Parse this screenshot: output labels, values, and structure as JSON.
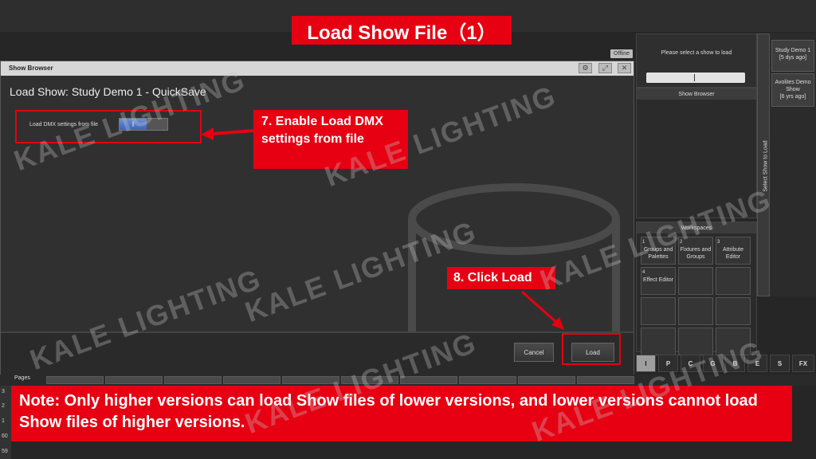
{
  "banner_title": "Load Show File（1）",
  "offline_label": "Offline",
  "dialog": {
    "header": "Show Browser",
    "title": "Load Show: Study Demo 1 - QuickSave",
    "option_label": "Load DMX settings from file",
    "toggle_value": "I",
    "cancel_label": "Cancel",
    "load_label": "Load"
  },
  "right_panel": {
    "select_prompt": "Please select a show to load",
    "progress_value": "I",
    "browser_label": "Show Browser",
    "vertical_label": "Select Show to Load",
    "shows": [
      {
        "name": "Study Demo 1",
        "age": "[5 dys ago]"
      },
      {
        "name": "Avolites Demo Show",
        "age": "[6 yrs ago]"
      }
    ],
    "workspaces_label": "Workspaces",
    "workspaces": [
      {
        "num": "1",
        "name": "Groups and Palettes"
      },
      {
        "num": "2",
        "name": "Fixtures and Groups"
      },
      {
        "num": "3",
        "name": "Attribute Editor"
      },
      {
        "num": "4",
        "name": "Effect Editor"
      },
      {
        "num": "",
        "name": ""
      },
      {
        "num": "",
        "name": ""
      },
      {
        "num": "",
        "name": ""
      },
      {
        "num": "",
        "name": ""
      },
      {
        "num": "",
        "name": ""
      },
      {
        "num": "",
        "name": ""
      },
      {
        "num": "",
        "name": ""
      },
      {
        "num": "",
        "name": ""
      }
    ],
    "modes": [
      "I",
      "P",
      "C",
      "G",
      "B",
      "E",
      "S",
      "FX"
    ]
  },
  "pages_label": "Pages",
  "left_numbers": [
    "3",
    "2",
    "1",
    "60",
    "59"
  ],
  "annotations": {
    "step7": "7. Enable Load DMX settings from file",
    "step8": "8. Click Load",
    "note": "Note: Only higher versions can load Show files of lower versions, and lower versions cannot load Show files of higher versions."
  },
  "watermark": "KALE LIGHTING",
  "colors": {
    "annotation_red": "#e60012",
    "toggle_blue": "#4a6fc4",
    "background": "#262626"
  }
}
